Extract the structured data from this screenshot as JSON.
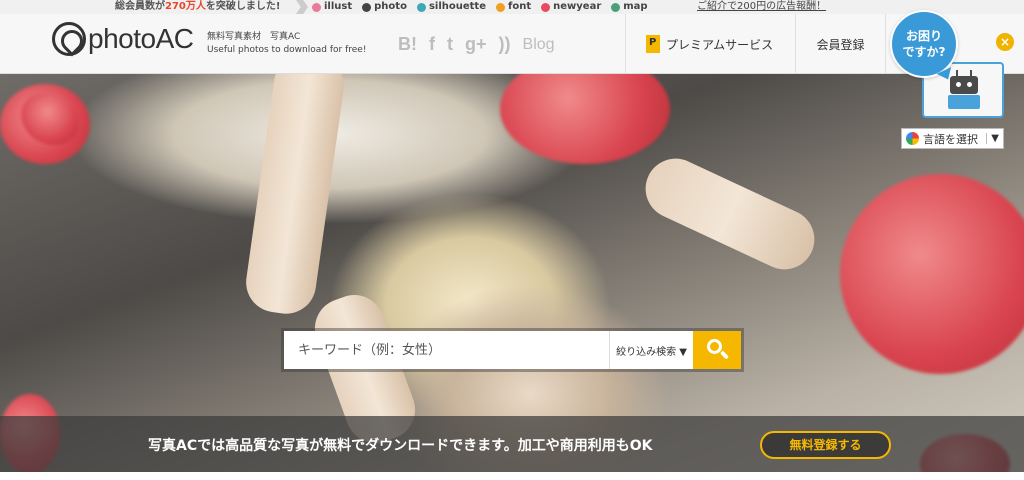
{
  "topbar": {
    "members_prefix": "総会員数が",
    "members_count": "270万人",
    "members_suffix": "を突破しました!",
    "sites": [
      {
        "label": "illust",
        "icon": "illust-icon",
        "color": "#e87a9a"
      },
      {
        "label": "photo",
        "icon": "photo-icon",
        "color": "#444444"
      },
      {
        "label": "silhouette",
        "icon": "silhouette-icon",
        "color": "#3aa8b8"
      },
      {
        "label": "font",
        "icon": "font-icon",
        "color": "#f0a020"
      },
      {
        "label": "newyear",
        "icon": "newyear-icon",
        "color": "#e84a5f"
      },
      {
        "label": "map",
        "icon": "map-icon",
        "color": "#4aa07a"
      }
    ],
    "ad_link": "ご紹介で200円の広告報酬！"
  },
  "header": {
    "logo_text": "photo",
    "logo_ac": "AC",
    "tagline_line1": "無料写真素材　写真AC",
    "tagline_line2": "Useful photos to download for free!",
    "social": {
      "hatena": "B!",
      "facebook": "f",
      "twitter": "t",
      "googleplus": "g+",
      "rss": "))",
      "blog": "Blog"
    },
    "premium_label": "プレミアムサービス",
    "member_label": "会員登録",
    "help_line1": "お困り",
    "help_line2": "ですか?",
    "close_label": "×",
    "lang_label": "言語を選択",
    "lang_arrow": "▼"
  },
  "search": {
    "placeholder": "キーワード（例：女性）",
    "filter_label": "絞り込み検索 ▼"
  },
  "banner": {
    "message": "写真ACでは高品質な写真が無料でダウンロードできます。加工や商用利用もOK",
    "cta_label": "無料登録する"
  },
  "colors": {
    "accent": "#f5b700",
    "help_blue": "#3a9ad8"
  }
}
